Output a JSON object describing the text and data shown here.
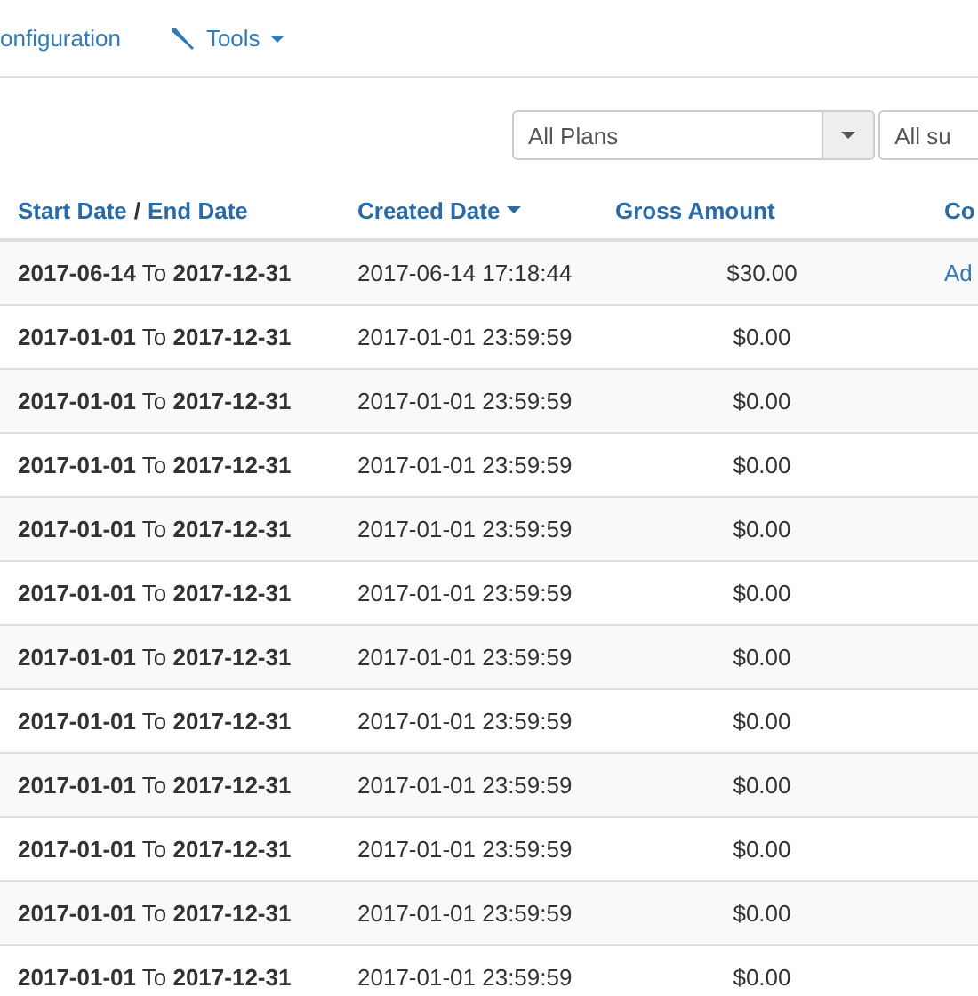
{
  "nav": [
    {
      "label": "onfiguration",
      "kind": "link"
    },
    {
      "label": "Tools",
      "kind": "dropdown"
    }
  ],
  "filters": [
    {
      "value": "All Plans",
      "kind": "select-with-button"
    },
    {
      "value": "All su",
      "kind": "select"
    }
  ],
  "table": {
    "columns": [
      {
        "label_parts": [
          "Start Date",
          "/",
          "End Date"
        ],
        "sorted": false
      },
      {
        "label_parts": [
          "Created Date"
        ],
        "sorted": true
      },
      {
        "label_parts": [
          "Gross Amount"
        ],
        "sorted": false
      },
      {
        "label_parts": [
          "Co"
        ],
        "sorted": false
      }
    ],
    "rows": [
      {
        "dates": "**2017-06-14** To **2017-12-31**",
        "created": "2017-06-14 17:18:44",
        "amount": "$30.00",
        "column_4": "Ad"
      },
      {
        "dates": "**2017-01-01** To **2017-12-31**",
        "created": "2017-01-01 23:59:59",
        "amount": "$0.00"
      },
      {
        "dates": "**2017-01-01** To **2017-12-31**",
        "created": "2017-01-01 23:59:59",
        "amount": "$0.00"
      },
      {
        "dates": "**2017-01-01** To **2017-12-31**",
        "created": "2017-01-01 23:59:59",
        "amount": "$0.00"
      },
      {
        "dates": "**2017-01-01** To **2017-12-31**",
        "created": "2017-01-01 23:59:59",
        "amount": "$0.00"
      },
      {
        "dates": "**2017-01-01** To **2017-12-31**",
        "created": "2017-01-01 23:59:59",
        "amount": "$0.00"
      },
      {
        "dates": "**2017-01-01** To **2017-12-31**",
        "created": "2017-01-01 23:59:59",
        "amount": "$0.00"
      },
      {
        "dates": "**2017-01-01** To **2017-12-31**",
        "created": "2017-01-01 23:59:59",
        "amount": "$0.00"
      },
      {
        "dates": "**2017-01-01** To **2017-12-31**",
        "created": "2017-01-01 23:59:59",
        "amount": "$0.00"
      },
      {
        "dates": "**2017-01-01** To **2017-12-31**",
        "created": "2017-01-01 23:59:59",
        "amount": "$0.00"
      },
      {
        "dates": "**2017-01-01** To **2017-12-31**",
        "created": "2017-01-01 23:59:59",
        "amount": "$0.00"
      },
      {
        "dates": "**2017-01-01** To **2017-12-31**",
        "created": "2017-01-01 23:59:59",
        "amount": "$0.00"
      }
    ]
  }
}
